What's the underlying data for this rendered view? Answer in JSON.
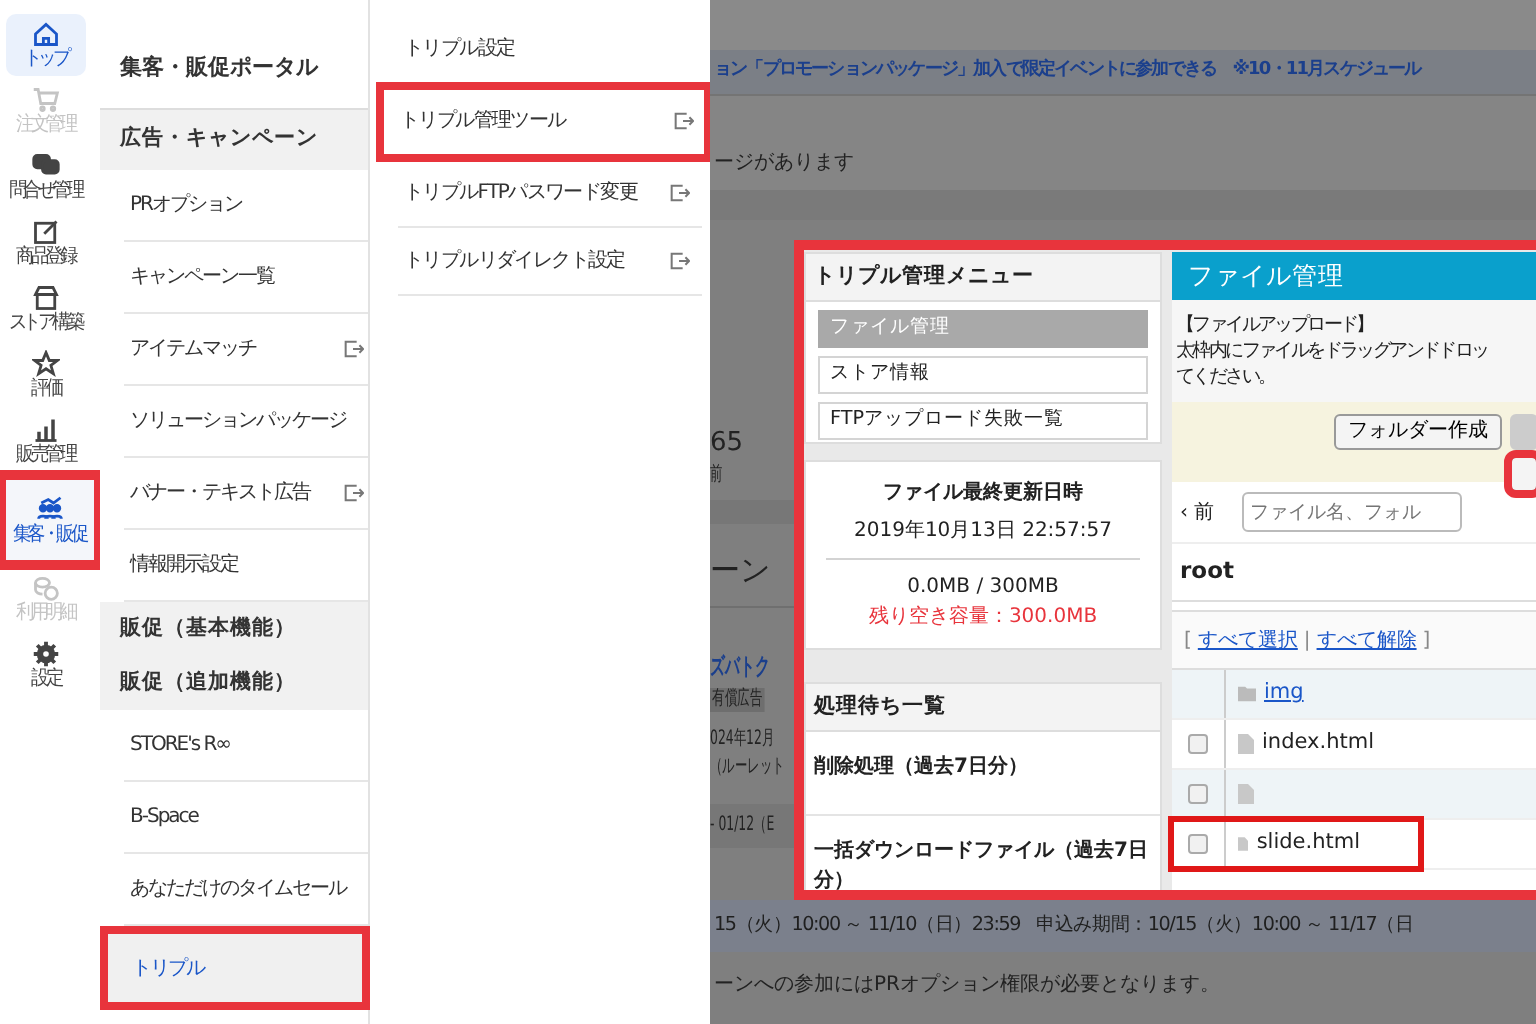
{
  "rail": [
    {
      "label": "トップ",
      "selected": true,
      "disabled": false,
      "highlighted": false
    },
    {
      "label": "注文管理",
      "selected": false,
      "disabled": true,
      "highlighted": false
    },
    {
      "label": "問合せ管理",
      "selected": false,
      "disabled": false,
      "highlighted": false
    },
    {
      "label": "商品登録",
      "selected": false,
      "disabled": false,
      "highlighted": false
    },
    {
      "label": "ストア構築",
      "selected": false,
      "disabled": false,
      "highlighted": false
    },
    {
      "label": "評価",
      "selected": false,
      "disabled": false,
      "highlighted": false
    },
    {
      "label": "販売管理",
      "selected": false,
      "disabled": false,
      "highlighted": false
    },
    {
      "label": "集客・販促",
      "selected": true,
      "disabled": false,
      "highlighted": true
    },
    {
      "label": "利用明細",
      "selected": false,
      "disabled": true,
      "highlighted": false
    },
    {
      "label": "設定",
      "selected": false,
      "disabled": false,
      "highlighted": false
    }
  ],
  "menu": {
    "title": "集客・販促ポータル",
    "sections": [
      {
        "heading": "広告・キャンペーン",
        "items": [
          {
            "label": "PRオプション",
            "external": false,
            "selected": false,
            "highlighted": false
          },
          {
            "label": "キャンペーン一覧",
            "external": false,
            "selected": false,
            "highlighted": false
          },
          {
            "label": "アイテムマッチ",
            "external": true,
            "selected": false,
            "highlighted": false
          },
          {
            "label": "ソリューションパッケージ",
            "external": false,
            "selected": false,
            "highlighted": false
          },
          {
            "label": "バナー・テキスト広告",
            "external": true,
            "selected": false,
            "highlighted": false
          },
          {
            "label": "情報開示設定",
            "external": false,
            "selected": false,
            "highlighted": false
          }
        ]
      },
      {
        "heading": "販促（基本機能）"
      },
      {
        "heading": "販促（追加機能）",
        "items": [
          {
            "label": "STORE's R∞",
            "external": false,
            "selected": false,
            "highlighted": false
          },
          {
            "label": "B-Space",
            "external": false,
            "selected": false,
            "highlighted": false
          },
          {
            "label": "あなただけのタイムセール",
            "external": false,
            "selected": false,
            "highlighted": false
          },
          {
            "label": "トリプル",
            "external": false,
            "selected": true,
            "highlighted": true
          }
        ]
      }
    ]
  },
  "submenu": [
    {
      "label": "トリプル設定",
      "external": false,
      "highlighted": false
    },
    {
      "label": "トリプル管理ツール",
      "external": true,
      "highlighted": true
    },
    {
      "label": "トリプルFTPパスワード変更",
      "external": true,
      "highlighted": false
    },
    {
      "label": "トリプルリダイレクト設定",
      "external": true,
      "highlighted": false
    }
  ],
  "background_page": {
    "banner": "ョン「プロモーションパッケージ」加入で限定イベントに参加できる　※10・11月スケジュール",
    "notice": "ージがあります",
    "stat": {
      "value": "65",
      "label": "前"
    },
    "section_title": "ーン",
    "campaign": {
      "title": "ズバトク",
      "tag": "有償広告",
      "lines": [
        "024年12月",
        "（ルーレット"
      ],
      "period": "- 01/12（E"
    },
    "schedule": {
      "event_period": "15（火）10:00 ～ 11/10（日）23:59",
      "application_period": "申込み期間：10/15（火）10:00 ～ 11/17（日"
    },
    "footnote": "ーンへの参加にはPRオプション権限が必要となります。"
  },
  "inset": {
    "highlighted": true,
    "menu": {
      "title": "トリプル管理メニュー",
      "items": [
        {
          "label": "ファイル管理",
          "selected": true
        },
        {
          "label": "ストア情報",
          "selected": false
        },
        {
          "label": "FTPアップロード失敗一覧",
          "selected": false
        }
      ]
    },
    "last_updated": {
      "heading": "ファイル最終更新日時",
      "datetime": "2019年10月13日 22:57:57",
      "usage": "0.0MB / 300MB",
      "remaining": "残り空き容量：300.0MB"
    },
    "queue": {
      "title": "処理待ち一覧",
      "items": [
        "削除処理（過去7日分）",
        "一括ダウンロードファイル（過去7日分）"
      ]
    },
    "file_manager": {
      "title": "ファイル管理",
      "upload_heading": "【ファイルアップロード】",
      "upload_lines": [
        "太枠内にファイルをドラッグアンドドロッ",
        "てください。"
      ],
      "buttons": [
        {
          "label": "フォルダー作成",
          "disabled": false,
          "highlighted": false
        },
        {
          "disabled": true,
          "highlighted": false
        },
        {
          "disabled": false,
          "highlighted": true
        }
      ],
      "back": "‹ 前",
      "search": {
        "placeholder": "ファイル名、フォル"
      },
      "path": "root",
      "selection": [
        {
          "kind": "punct",
          "text": "["
        },
        {
          "kind": "link",
          "text": "すべて選択"
        },
        {
          "kind": "punct",
          "text": "|"
        },
        {
          "kind": "link",
          "text": "すべて解除"
        },
        {
          "kind": "punct",
          "text": "]"
        }
      ],
      "rows": [
        {
          "kind": "folder",
          "name": "img"
        },
        {
          "kind": "file",
          "name": "index.html",
          "checked": false,
          "highlighted": false
        },
        {
          "kind": "file",
          "checked": false,
          "highlighted": false
        },
        {
          "kind": "file",
          "name": "slide.html",
          "checked": false,
          "highlighted": true
        }
      ]
    }
  }
}
